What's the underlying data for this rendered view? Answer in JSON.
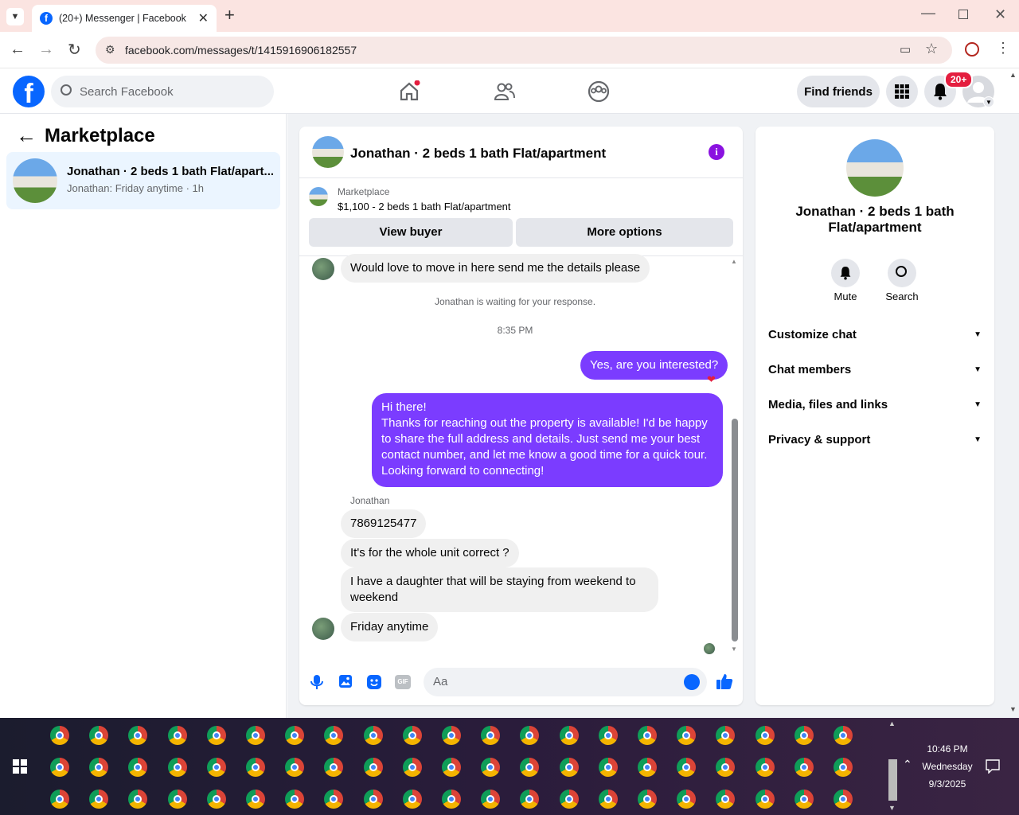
{
  "browser": {
    "tab_title": "(20+) Messenger | Facebook",
    "url": "facebook.com/messages/t/1415916906182557"
  },
  "fb_header": {
    "search_placeholder": "Search Facebook",
    "find_friends": "Find friends",
    "notification_badge": "20+"
  },
  "left_panel": {
    "title": "Marketplace",
    "conversation": {
      "title": "Jonathan · 2 beds 1 bath Flat/apart...",
      "subtitle": "Jonathan: Friday anytime · 1h"
    }
  },
  "chat": {
    "header_title": "Jonathan · 2 beds 1 bath Flat/apartment",
    "listing_source": "Marketplace",
    "listing_desc": "$1,100 - 2 beds 1 bath Flat/apartment",
    "view_buyer": "View buyer",
    "more_options": "More options",
    "msg_1": "Would love to move in here send me the details please",
    "waiting_notice": "Jonathan is waiting for your response.",
    "time_divider": "8:35 PM",
    "out_1": "Yes, are you interested?",
    "out_2_lines": [
      "Hi there!",
      "Thanks for reaching out the property is available! I'd be happy",
      "to share the full address and details. Just send me your best",
      "contact number, and let me know a good time for a quick tour.",
      "Looking forward to connecting!"
    ],
    "sender_name": "Jonathan",
    "in_1": "7869125477",
    "in_2": "It's for the whole unit correct ?",
    "in_3_lines": [
      "I have a daughter that will be staying from weekend to",
      "weekend"
    ],
    "in_4": "Friday anytime",
    "composer_placeholder": "Aa"
  },
  "info_panel": {
    "title_lines": [
      "Jonathan · 2 beds 1 bath",
      "Flat/apartment"
    ],
    "mute": "Mute",
    "search": "Search",
    "sections": [
      "Customize chat",
      "Chat members",
      "Media, files and links",
      "Privacy & support"
    ]
  },
  "taskbar": {
    "time": "10:46 PM",
    "day": "Wednesday",
    "date": "9/3/2025"
  }
}
